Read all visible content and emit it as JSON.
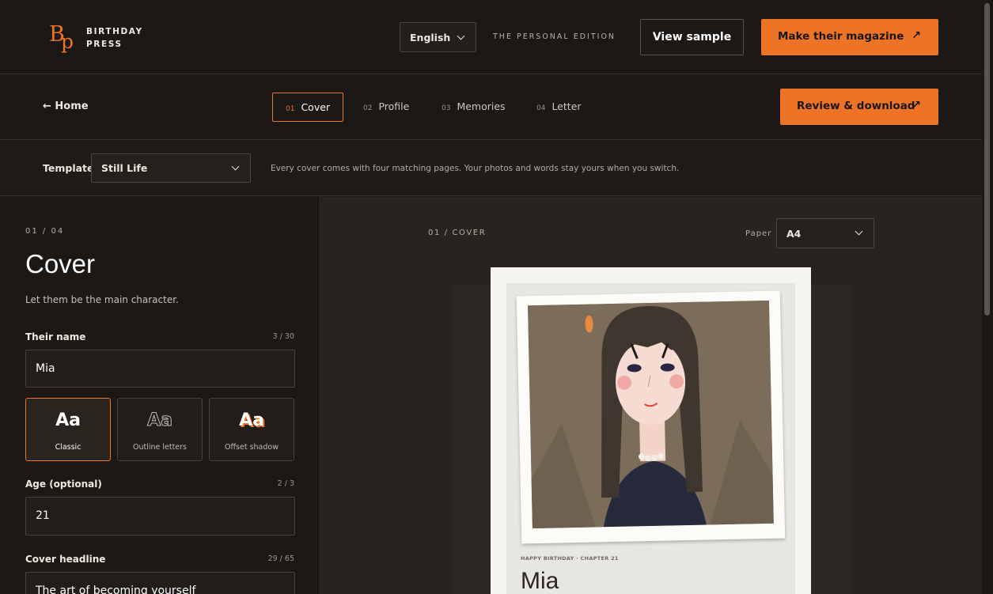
{
  "brand": {
    "line1": "BIRTHDAY",
    "line2": "PRESS",
    "mark_b": "B",
    "mark_p": "p"
  },
  "header": {
    "language": "English",
    "edition": "THE PERSONAL EDITION",
    "view_sample": "View sample",
    "make_magazine": "Make their magazine",
    "arrow": "↗"
  },
  "steps": {
    "home": "← Home",
    "items": [
      {
        "num": "01",
        "label": "Cover"
      },
      {
        "num": "02",
        "label": "Profile"
      },
      {
        "num": "03",
        "label": "Memories"
      },
      {
        "num": "04",
        "label": "Letter"
      }
    ],
    "review": "Review & download",
    "arrow": "↗"
  },
  "template": {
    "label": "Template",
    "selected": "Still Life",
    "hint": "Every cover comes with four matching pages. Your photos and words stay yours when you switch."
  },
  "form": {
    "counter": "01 / 04",
    "title": "Cover",
    "subtitle": "Let them be the main character.",
    "name_label": "Their name",
    "name_count": "3 / 30",
    "name_value": "Mia",
    "styles": [
      {
        "glyph": "Aa",
        "label": "Classic"
      },
      {
        "glyph": "Aa",
        "label": "Outline letters"
      },
      {
        "glyph": "Aa",
        "label": "Offset shadow"
      }
    ],
    "age_label": "Age (optional)",
    "age_count": "2 / 3",
    "age_value": "21",
    "headline_label": "Cover headline",
    "headline_count": "29 / 65",
    "headline_value": "The art of becoming yourself"
  },
  "preview": {
    "counter": "01 / COVER",
    "paper_label": "Paper",
    "paper_value": "A4",
    "kicker": "HAPPY BIRTHDAY · CHAPTER 21",
    "name": "Mia"
  },
  "colors": {
    "accent": "#ed7326",
    "background": "#1d1a17",
    "preview_bg": "#27231f"
  }
}
